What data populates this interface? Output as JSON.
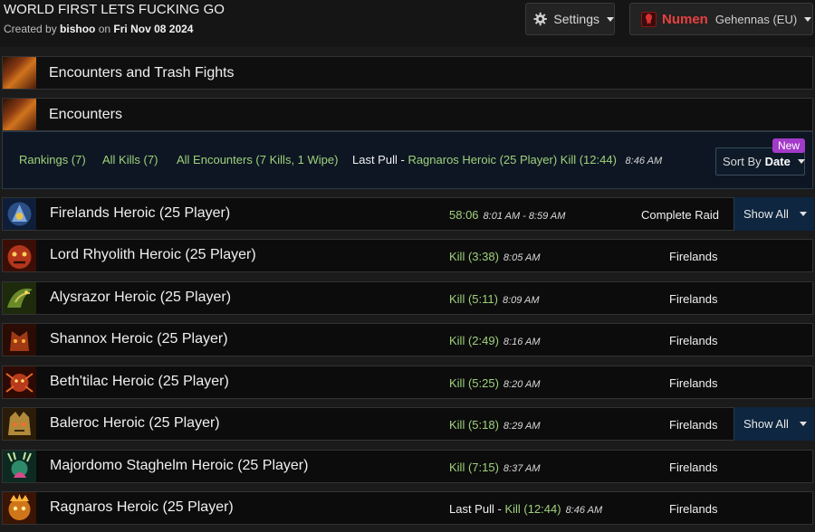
{
  "header": {
    "title": "WORLD FIRST LETS FUCKING GO",
    "created_by_prefix": "Created by",
    "author": "bishoo",
    "on_word": "on",
    "date": "Fri Nov 08 2024",
    "settings_label": "Settings",
    "character_name": "Numen",
    "character_server": "Gehennas (EU)"
  },
  "sections": {
    "encounters_trash": "Encounters and Trash Fights",
    "encounters": "Encounters"
  },
  "tabs": {
    "rankings": "Rankings (7)",
    "all_kills": "All Kills (7)",
    "all_encounters": "All Encounters (7 Kills, 1 Wipe)",
    "last_pull_label": "Last Pull -",
    "last_pull_value": "Ragnaros Heroic (25 Player) Kill (12:44)",
    "last_pull_time": "8:46 AM",
    "sort_by_label": "Sort By",
    "sort_by_value": "Date",
    "new_badge": "New"
  },
  "rows": [
    {
      "name": "Firelands Heroic (25 Player)",
      "result": "58:06",
      "time": "8:01 AM - 8:59 AM",
      "zone": "Complete Raid",
      "show_all": "Show All",
      "icon": "firelands-icon",
      "icon_color": "#2b4f86"
    },
    {
      "name": "Lord Rhyolith Heroic (25 Player)",
      "result": "Kill (3:38)",
      "time": "8:05 AM",
      "zone": "Firelands",
      "icon": "lord-rhyolith-icon",
      "icon_color": "#b3361a"
    },
    {
      "name": "Alysrazor Heroic (25 Player)",
      "result": "Kill (5:11)",
      "time": "8:09 AM",
      "zone": "Firelands",
      "icon": "alysrazor-icon",
      "icon_color": "#6a8a2a"
    },
    {
      "name": "Shannox Heroic (25 Player)",
      "result": "Kill (2:49)",
      "time": "8:16 AM",
      "zone": "Firelands",
      "icon": "shannox-icon",
      "icon_color": "#a13a14"
    },
    {
      "name": "Beth'tilac Heroic (25 Player)",
      "result": "Kill (5:25)",
      "time": "8:20 AM",
      "zone": "Firelands",
      "icon": "bethtilac-icon",
      "icon_color": "#b83a1c"
    },
    {
      "name": "Baleroc Heroic (25 Player)",
      "result": "Kill (5:18)",
      "time": "8:29 AM",
      "zone": "Firelands",
      "show_all": "Show All",
      "icon": "baleroc-icon",
      "icon_color": "#b08a3a"
    },
    {
      "name": "Majordomo Staghelm Heroic (25 Player)",
      "result": "Kill (7:15)",
      "time": "8:37 AM",
      "zone": "Firelands",
      "icon": "majordomo-staghelm-icon",
      "icon_color": "#2f8a6a"
    },
    {
      "name": "Ragnaros Heroic (25 Player)",
      "result_prefix": "Last Pull -",
      "result": "Kill (12:44)",
      "time": "8:46 AM",
      "zone": "Firelands",
      "icon": "ragnaros-icon",
      "icon_color": "#d0761a"
    }
  ],
  "colors": {
    "kill_green": "#9fd17d",
    "character_red": "#e84040",
    "new_badge_purple": "#a33ac9"
  }
}
